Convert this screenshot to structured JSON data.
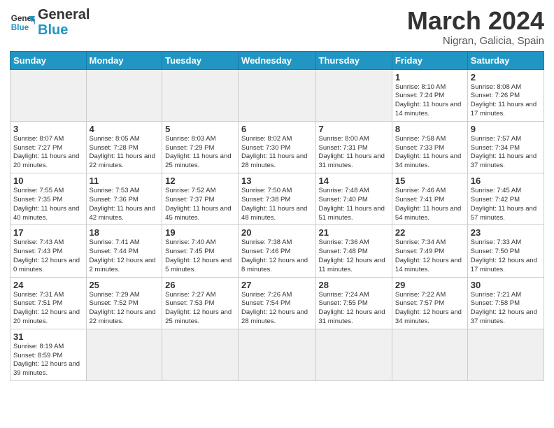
{
  "header": {
    "logo_general": "General",
    "logo_blue": "Blue",
    "month_title": "March 2024",
    "subtitle": "Nigran, Galicia, Spain"
  },
  "days_of_week": [
    "Sunday",
    "Monday",
    "Tuesday",
    "Wednesday",
    "Thursday",
    "Friday",
    "Saturday"
  ],
  "weeks": [
    [
      {
        "date": "",
        "info": ""
      },
      {
        "date": "",
        "info": ""
      },
      {
        "date": "",
        "info": ""
      },
      {
        "date": "",
        "info": ""
      },
      {
        "date": "",
        "info": ""
      },
      {
        "date": "1",
        "info": "Sunrise: 8:10 AM\nSunset: 7:24 PM\nDaylight: 11 hours and 14 minutes."
      },
      {
        "date": "2",
        "info": "Sunrise: 8:08 AM\nSunset: 7:26 PM\nDaylight: 11 hours and 17 minutes."
      }
    ],
    [
      {
        "date": "3",
        "info": "Sunrise: 8:07 AM\nSunset: 7:27 PM\nDaylight: 11 hours and 20 minutes."
      },
      {
        "date": "4",
        "info": "Sunrise: 8:05 AM\nSunset: 7:28 PM\nDaylight: 11 hours and 22 minutes."
      },
      {
        "date": "5",
        "info": "Sunrise: 8:03 AM\nSunset: 7:29 PM\nDaylight: 11 hours and 25 minutes."
      },
      {
        "date": "6",
        "info": "Sunrise: 8:02 AM\nSunset: 7:30 PM\nDaylight: 11 hours and 28 minutes."
      },
      {
        "date": "7",
        "info": "Sunrise: 8:00 AM\nSunset: 7:31 PM\nDaylight: 11 hours and 31 minutes."
      },
      {
        "date": "8",
        "info": "Sunrise: 7:58 AM\nSunset: 7:33 PM\nDaylight: 11 hours and 34 minutes."
      },
      {
        "date": "9",
        "info": "Sunrise: 7:57 AM\nSunset: 7:34 PM\nDaylight: 11 hours and 37 minutes."
      }
    ],
    [
      {
        "date": "10",
        "info": "Sunrise: 7:55 AM\nSunset: 7:35 PM\nDaylight: 11 hours and 40 minutes."
      },
      {
        "date": "11",
        "info": "Sunrise: 7:53 AM\nSunset: 7:36 PM\nDaylight: 11 hours and 42 minutes."
      },
      {
        "date": "12",
        "info": "Sunrise: 7:52 AM\nSunset: 7:37 PM\nDaylight: 11 hours and 45 minutes."
      },
      {
        "date": "13",
        "info": "Sunrise: 7:50 AM\nSunset: 7:38 PM\nDaylight: 11 hours and 48 minutes."
      },
      {
        "date": "14",
        "info": "Sunrise: 7:48 AM\nSunset: 7:40 PM\nDaylight: 11 hours and 51 minutes."
      },
      {
        "date": "15",
        "info": "Sunrise: 7:46 AM\nSunset: 7:41 PM\nDaylight: 11 hours and 54 minutes."
      },
      {
        "date": "16",
        "info": "Sunrise: 7:45 AM\nSunset: 7:42 PM\nDaylight: 11 hours and 57 minutes."
      }
    ],
    [
      {
        "date": "17",
        "info": "Sunrise: 7:43 AM\nSunset: 7:43 PM\nDaylight: 12 hours and 0 minutes."
      },
      {
        "date": "18",
        "info": "Sunrise: 7:41 AM\nSunset: 7:44 PM\nDaylight: 12 hours and 2 minutes."
      },
      {
        "date": "19",
        "info": "Sunrise: 7:40 AM\nSunset: 7:45 PM\nDaylight: 12 hours and 5 minutes."
      },
      {
        "date": "20",
        "info": "Sunrise: 7:38 AM\nSunset: 7:46 PM\nDaylight: 12 hours and 8 minutes."
      },
      {
        "date": "21",
        "info": "Sunrise: 7:36 AM\nSunset: 7:48 PM\nDaylight: 12 hours and 11 minutes."
      },
      {
        "date": "22",
        "info": "Sunrise: 7:34 AM\nSunset: 7:49 PM\nDaylight: 12 hours and 14 minutes."
      },
      {
        "date": "23",
        "info": "Sunrise: 7:33 AM\nSunset: 7:50 PM\nDaylight: 12 hours and 17 minutes."
      }
    ],
    [
      {
        "date": "24",
        "info": "Sunrise: 7:31 AM\nSunset: 7:51 PM\nDaylight: 12 hours and 20 minutes."
      },
      {
        "date": "25",
        "info": "Sunrise: 7:29 AM\nSunset: 7:52 PM\nDaylight: 12 hours and 22 minutes."
      },
      {
        "date": "26",
        "info": "Sunrise: 7:27 AM\nSunset: 7:53 PM\nDaylight: 12 hours and 25 minutes."
      },
      {
        "date": "27",
        "info": "Sunrise: 7:26 AM\nSunset: 7:54 PM\nDaylight: 12 hours and 28 minutes."
      },
      {
        "date": "28",
        "info": "Sunrise: 7:24 AM\nSunset: 7:55 PM\nDaylight: 12 hours and 31 minutes."
      },
      {
        "date": "29",
        "info": "Sunrise: 7:22 AM\nSunset: 7:57 PM\nDaylight: 12 hours and 34 minutes."
      },
      {
        "date": "30",
        "info": "Sunrise: 7:21 AM\nSunset: 7:58 PM\nDaylight: 12 hours and 37 minutes."
      }
    ],
    [
      {
        "date": "31",
        "info": "Sunrise: 8:19 AM\nSunset: 8:59 PM\nDaylight: 12 hours and 39 minutes."
      },
      {
        "date": "",
        "info": ""
      },
      {
        "date": "",
        "info": ""
      },
      {
        "date": "",
        "info": ""
      },
      {
        "date": "",
        "info": ""
      },
      {
        "date": "",
        "info": ""
      },
      {
        "date": "",
        "info": ""
      }
    ]
  ]
}
